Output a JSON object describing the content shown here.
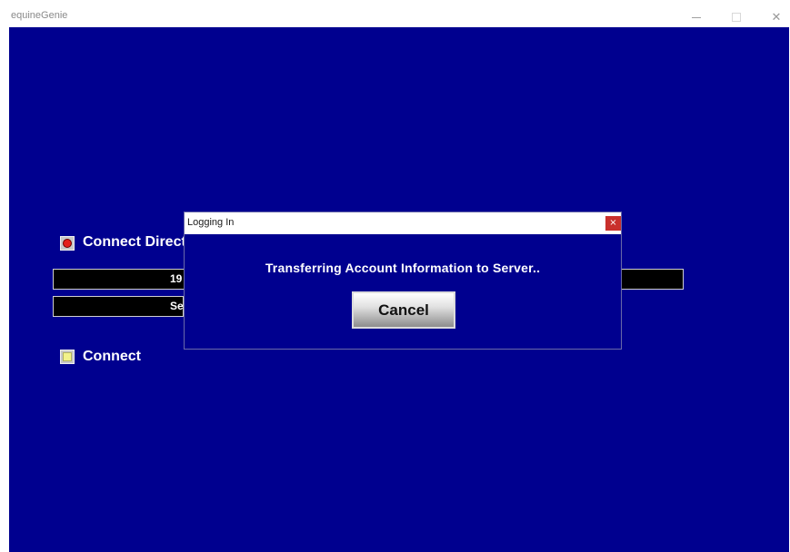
{
  "window": {
    "title": "equineGenie",
    "background_color": "#00008f",
    "controls": {
      "minimize_icon": "minimize-icon",
      "maximize_icon": "maximize-icon",
      "close_icon": "close-icon",
      "close_glyph": "✕"
    }
  },
  "main": {
    "connect_direct": {
      "label": "Connect Direct",
      "selected": true,
      "indicator_color": "#e3201b"
    },
    "ip_field": {
      "value": "19"
    },
    "server_field": {
      "value": "Se"
    },
    "connect": {
      "label": "Connect",
      "indicator_color": "#f2f28a"
    }
  },
  "dialog": {
    "title": "Logging In",
    "close_glyph": "×",
    "close_color": "#c9302c",
    "message": "Transferring Account Information to Server..",
    "cancel_label": "Cancel"
  }
}
